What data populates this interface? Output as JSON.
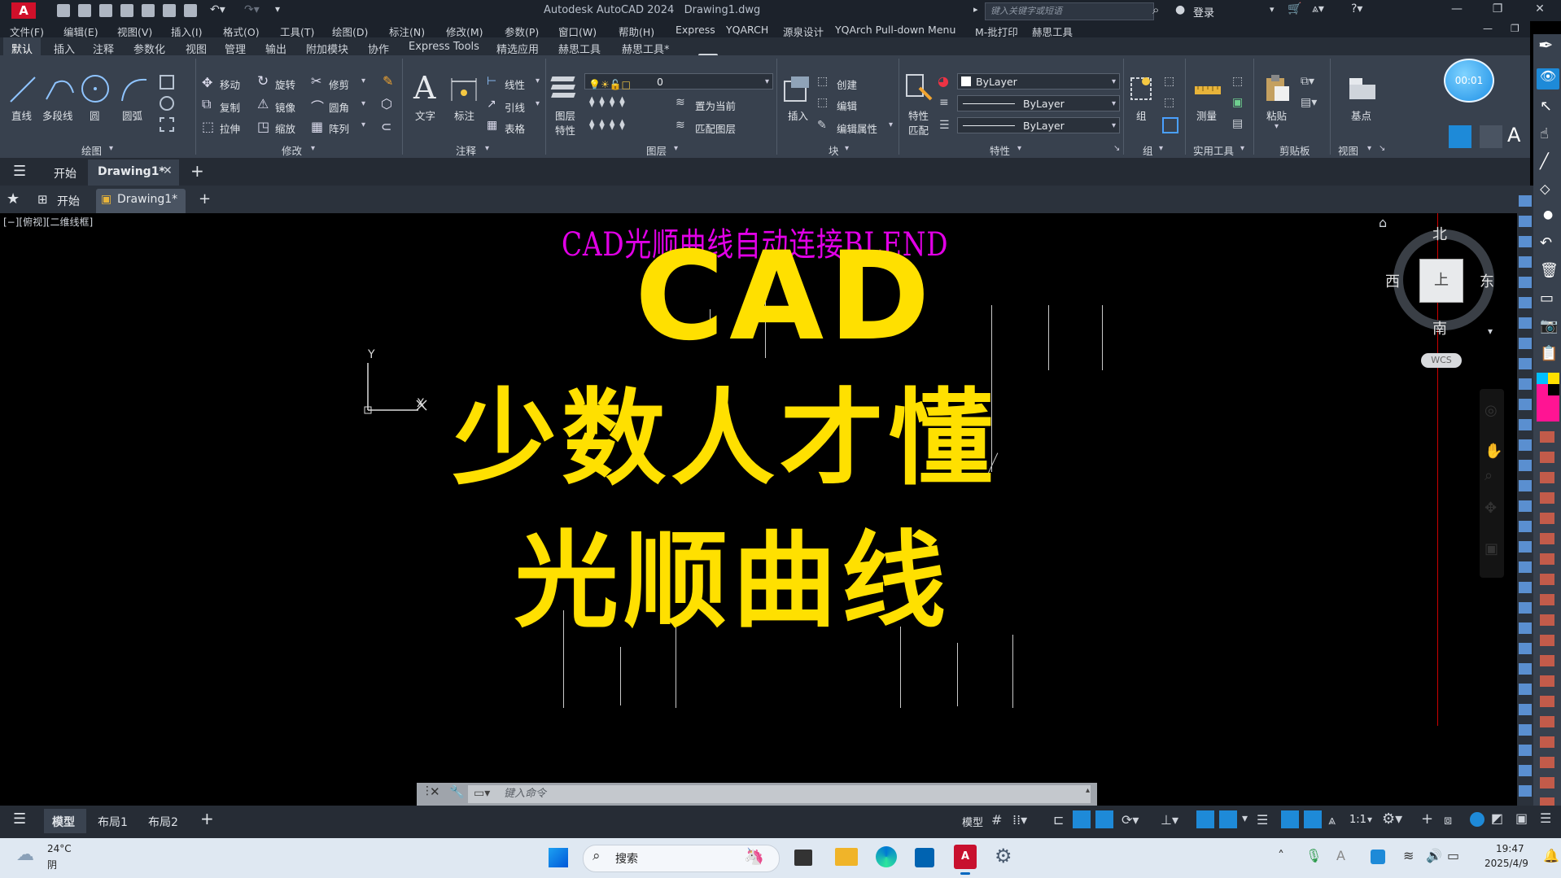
{
  "app": {
    "logo": "A",
    "title": "Autodesk AutoCAD 2024",
    "file": "Drawing1.dwg",
    "search_placeholder": "键入关键字或短语",
    "login": "登录"
  },
  "menu": [
    "文件(F)",
    "编辑(E)",
    "视图(V)",
    "插入(I)",
    "格式(O)",
    "工具(T)",
    "绘图(D)",
    "标注(N)",
    "修改(M)",
    "参数(P)",
    "窗口(W)",
    "帮助(H)",
    "Express",
    "YQARCH",
    "源泉设计",
    "YQArch Pull-down Menu",
    "M-批打印",
    "赫思工具"
  ],
  "ribbon_tabs": [
    "默认",
    "插入",
    "注释",
    "参数化",
    "视图",
    "管理",
    "输出",
    "附加模块",
    "协作",
    "Express Tools",
    "精选应用",
    "赫思工具",
    "赫思工具*"
  ],
  "ribbon": {
    "draw": {
      "title": "绘图",
      "line": "直线",
      "polyline": "多段线",
      "circle": "圆",
      "arc": "圆弧"
    },
    "modify": {
      "title": "修改",
      "move": "移动",
      "rotate": "旋转",
      "trim": "修剪",
      "copy": "复制",
      "mirror": "镜像",
      "fillet": "圆角",
      "stretch": "拉伸",
      "scale": "缩放",
      "array": "阵列"
    },
    "annotation": {
      "title": "注释",
      "text": "文字",
      "dimension": "标注",
      "linear": "线性",
      "leader": "引线",
      "table": "表格"
    },
    "layers": {
      "title": "图层",
      "layer_props": "图层",
      "layer_props2": "特性",
      "current_layer": "0",
      "set_current": "置为当前",
      "match_layer": "匹配图层"
    },
    "block": {
      "title": "块",
      "insert": "插入",
      "create": "创建",
      "edit": "编辑",
      "edit_attr": "编辑属性"
    },
    "properties": {
      "title": "特性",
      "match": "特性",
      "match2": "匹配",
      "color": "ByLayer",
      "linetype": "ByLayer",
      "lineweight": "ByLayer"
    },
    "groups": {
      "title": "组",
      "group": "组"
    },
    "utilities": {
      "title": "实用工具",
      "measure": "测量"
    },
    "clipboard": {
      "title": "剪贴板",
      "paste": "粘贴"
    },
    "view": {
      "title": "视图",
      "base": "基点"
    }
  },
  "timer": "00:01",
  "file_tabs": {
    "start": "开始",
    "drawing": "Drawing1*"
  },
  "doc_tabs": {
    "start": "开始",
    "drawing": "Drawing1*"
  },
  "viewport_label": "[−][俯视][二维线框]",
  "overlay": {
    "title": "CAD光顺曲线自动连接BLEND",
    "line1": "CAD",
    "line2": "少数人才懂",
    "line3": "光顺曲线"
  },
  "ucs": {
    "y": "Y",
    "x": "X"
  },
  "navcube": {
    "north": "北",
    "south": "南",
    "west": "西",
    "east": "东",
    "center": "上",
    "wcs": "WCS"
  },
  "command": {
    "placeholder": "键入命令"
  },
  "status": {
    "model": "模型",
    "layout1": "布局1",
    "layout2": "布局2",
    "model_btn": "模型",
    "scale": "1:1"
  },
  "taskbar": {
    "temp": "24°C",
    "weather": "阴",
    "search": "搜索",
    "time": "19:47",
    "date": "2025/4/9"
  }
}
